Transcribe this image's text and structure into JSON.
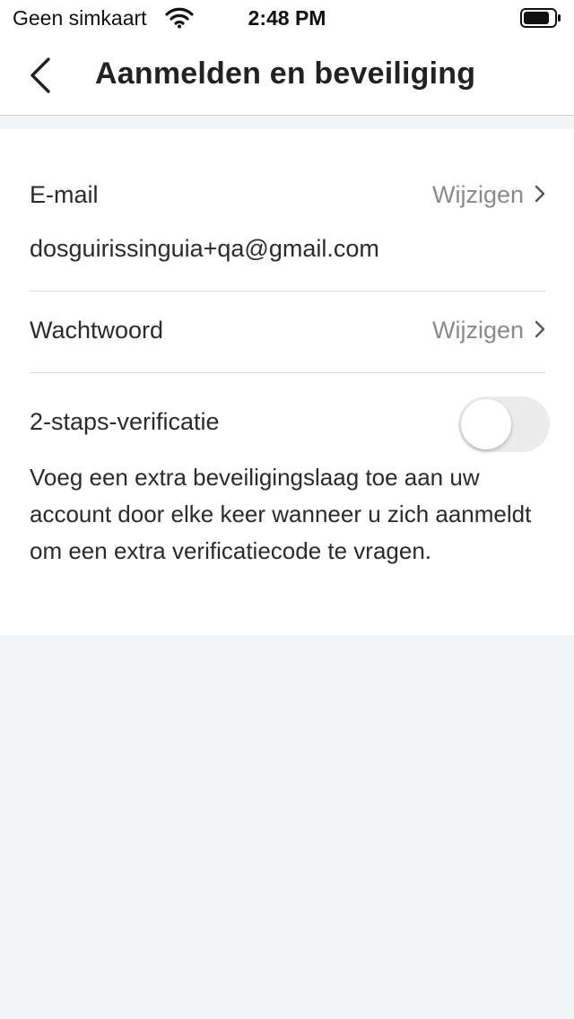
{
  "status_bar": {
    "carrier": "Geen simkaart",
    "time": "2:48 PM"
  },
  "nav": {
    "title": "Aanmelden en beveiliging"
  },
  "email_row": {
    "label": "E-mail",
    "action": "Wijzigen",
    "value": "dosguirissinguia+qa@gmail.com"
  },
  "password_row": {
    "label": "Wachtwoord",
    "action": "Wijzigen"
  },
  "two_step": {
    "label": "2-staps-verificatie",
    "enabled": false,
    "description": "Voeg een extra beveiligingslaag toe aan uw account door elke keer wanneer u zich aanmeldt om een extra verificatiecode te vragen."
  },
  "colors": {
    "background": "#f3f4f8",
    "card": "#ffffff",
    "text": "#2b2b2b",
    "action_text": "#8a8a8a",
    "toggle_off": "#ececec"
  },
  "icons": [
    "wifi-icon",
    "battery-icon",
    "back-chevron-icon",
    "chevron-right-icon"
  ]
}
